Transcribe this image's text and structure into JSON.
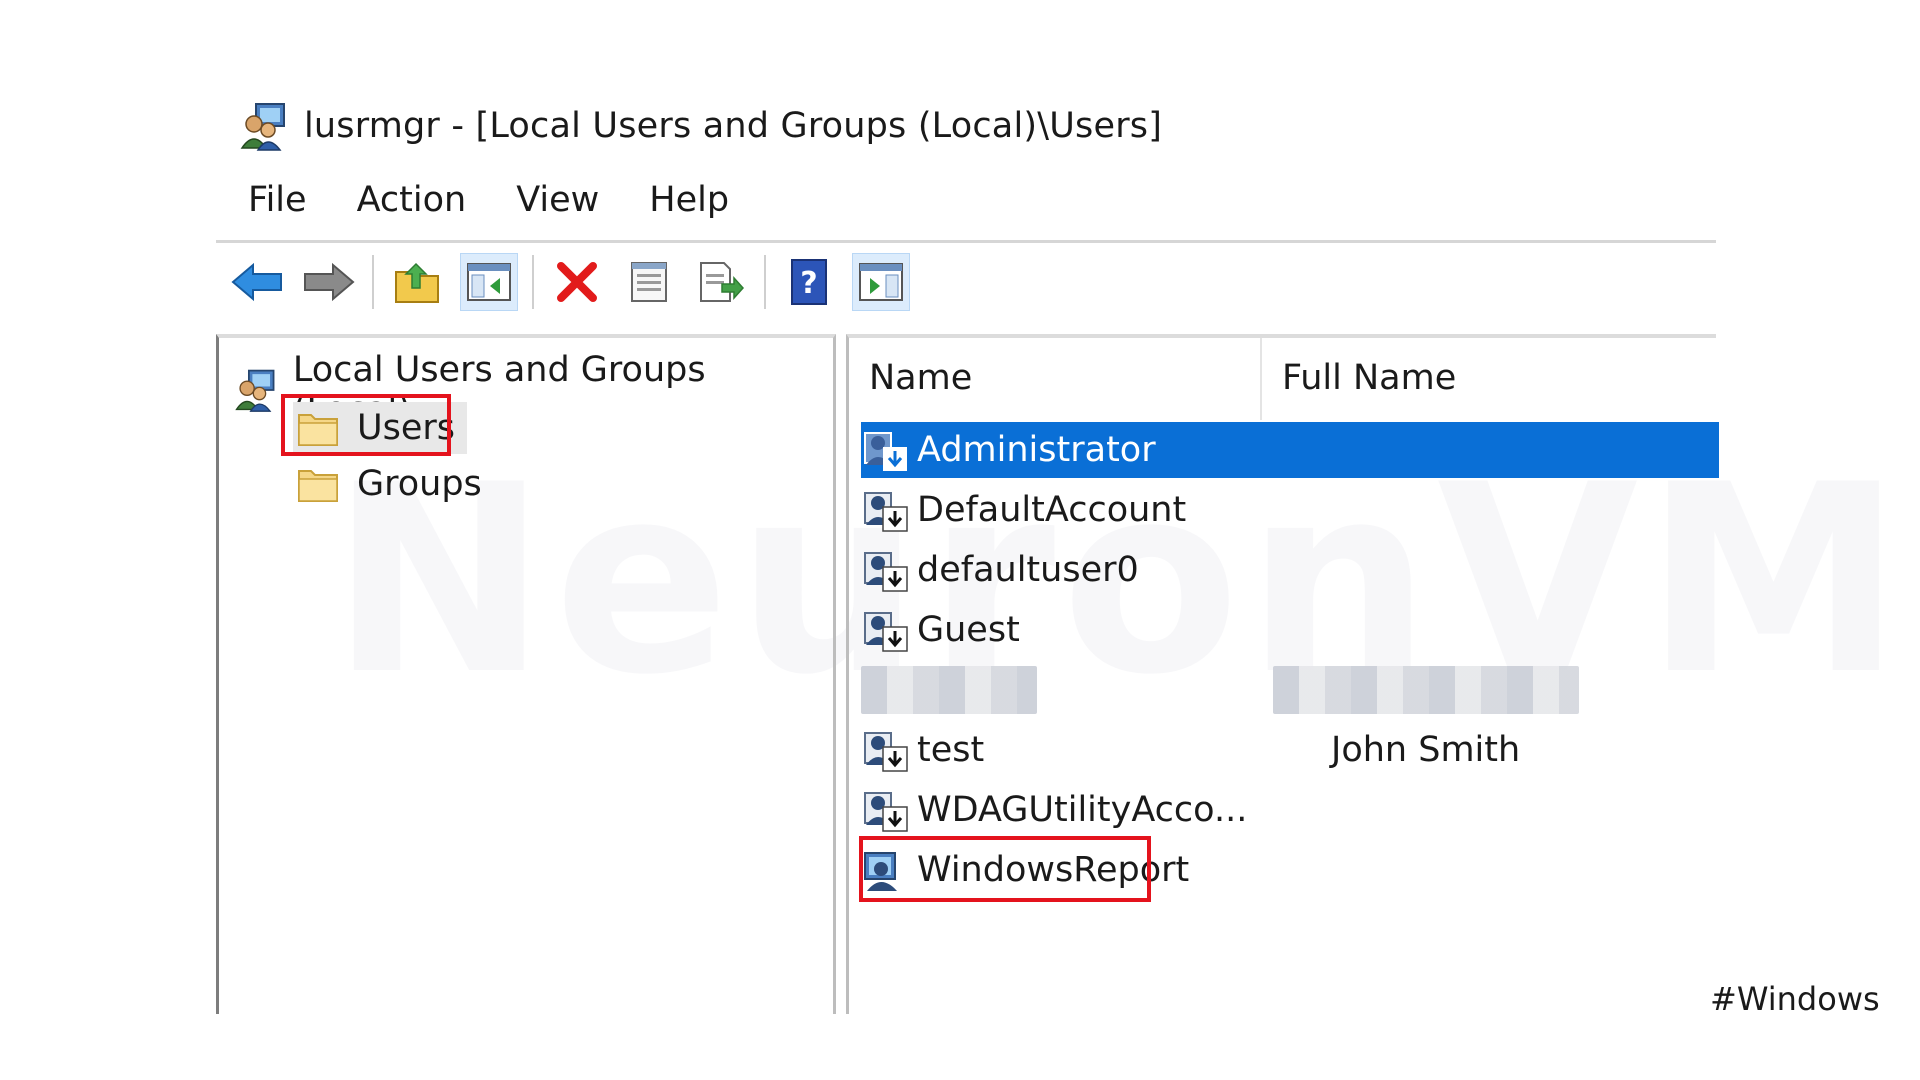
{
  "window": {
    "title": "lusrmgr - [Local Users and Groups (Local)\\Users]"
  },
  "menu": {
    "items": [
      "File",
      "Action",
      "View",
      "Help"
    ]
  },
  "toolbar": {
    "buttons": [
      {
        "icon": "back-arrow-icon"
      },
      {
        "icon": "forward-arrow-icon"
      },
      {
        "icon": "up-folder-icon"
      },
      {
        "icon": "show-hide-console-tree-icon"
      },
      {
        "icon": "delete-icon"
      },
      {
        "icon": "properties-icon"
      },
      {
        "icon": "export-list-icon"
      },
      {
        "icon": "help-icon"
      },
      {
        "icon": "show-hide-action-pane-icon"
      }
    ]
  },
  "tree": {
    "root": "Local Users and Groups (Local)",
    "nodes": [
      "Users",
      "Groups"
    ],
    "selected": "Users"
  },
  "list": {
    "columns": [
      "Name",
      "Full Name"
    ],
    "rows": [
      {
        "name": "Administrator",
        "full_name": "",
        "selected": true
      },
      {
        "name": "DefaultAccount",
        "full_name": ""
      },
      {
        "name": "defaultuser0",
        "full_name": ""
      },
      {
        "name": "Guest",
        "full_name": ""
      },
      {
        "name": "",
        "full_name": "",
        "redacted": true
      },
      {
        "name": "test",
        "full_name": "John Smith"
      },
      {
        "name": "WDAGUtilityAcco...",
        "full_name": ""
      },
      {
        "name": "WindowsReport",
        "full_name": "",
        "highlighted": true
      }
    ]
  },
  "watermark": "NeuronVM",
  "tag": "#Windows",
  "colors": {
    "selection": "#0a6fd6",
    "highlight_box": "#e4131d"
  }
}
